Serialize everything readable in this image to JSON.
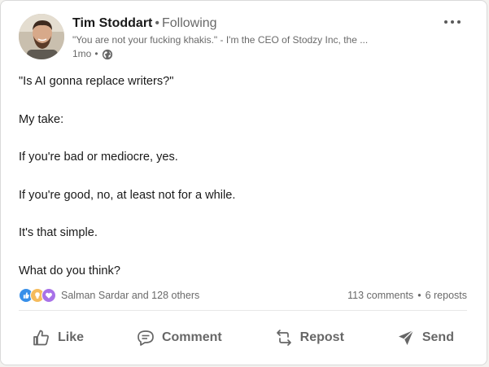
{
  "post": {
    "author_name": "Tim Stoddart",
    "separator": "•",
    "following": "Following",
    "headline": "\"You are not your fucking khakis.\" - I'm the CEO of Stodzy Inc, the ...",
    "time": "1mo",
    "time_separator": "•",
    "visibility_icon": "globe-icon",
    "menu_icon": "more-options-icon",
    "body": [
      "\"Is AI gonna replace writers?\"",
      "My take:",
      "If you're bad or mediocre, yes.",
      "If you're good, no, at least not for a while.",
      "It's that simple.",
      "What do you think?"
    ]
  },
  "social": {
    "reaction_icons": [
      "like-reaction-icon",
      "insightful-reaction-icon",
      "support-reaction-icon"
    ],
    "reactors": "Salman Sardar and 128 others",
    "comments": "113 comments",
    "counts_separator": "•",
    "reposts": "6 reposts"
  },
  "actions": {
    "like": "Like",
    "comment": "Comment",
    "repost": "Repost",
    "send": "Send"
  },
  "colors": {
    "like_blue": "#378fe9",
    "insightful_yellow": "#f5bb5c",
    "support_purple": "#a872e8",
    "muted_text": "#666666"
  }
}
